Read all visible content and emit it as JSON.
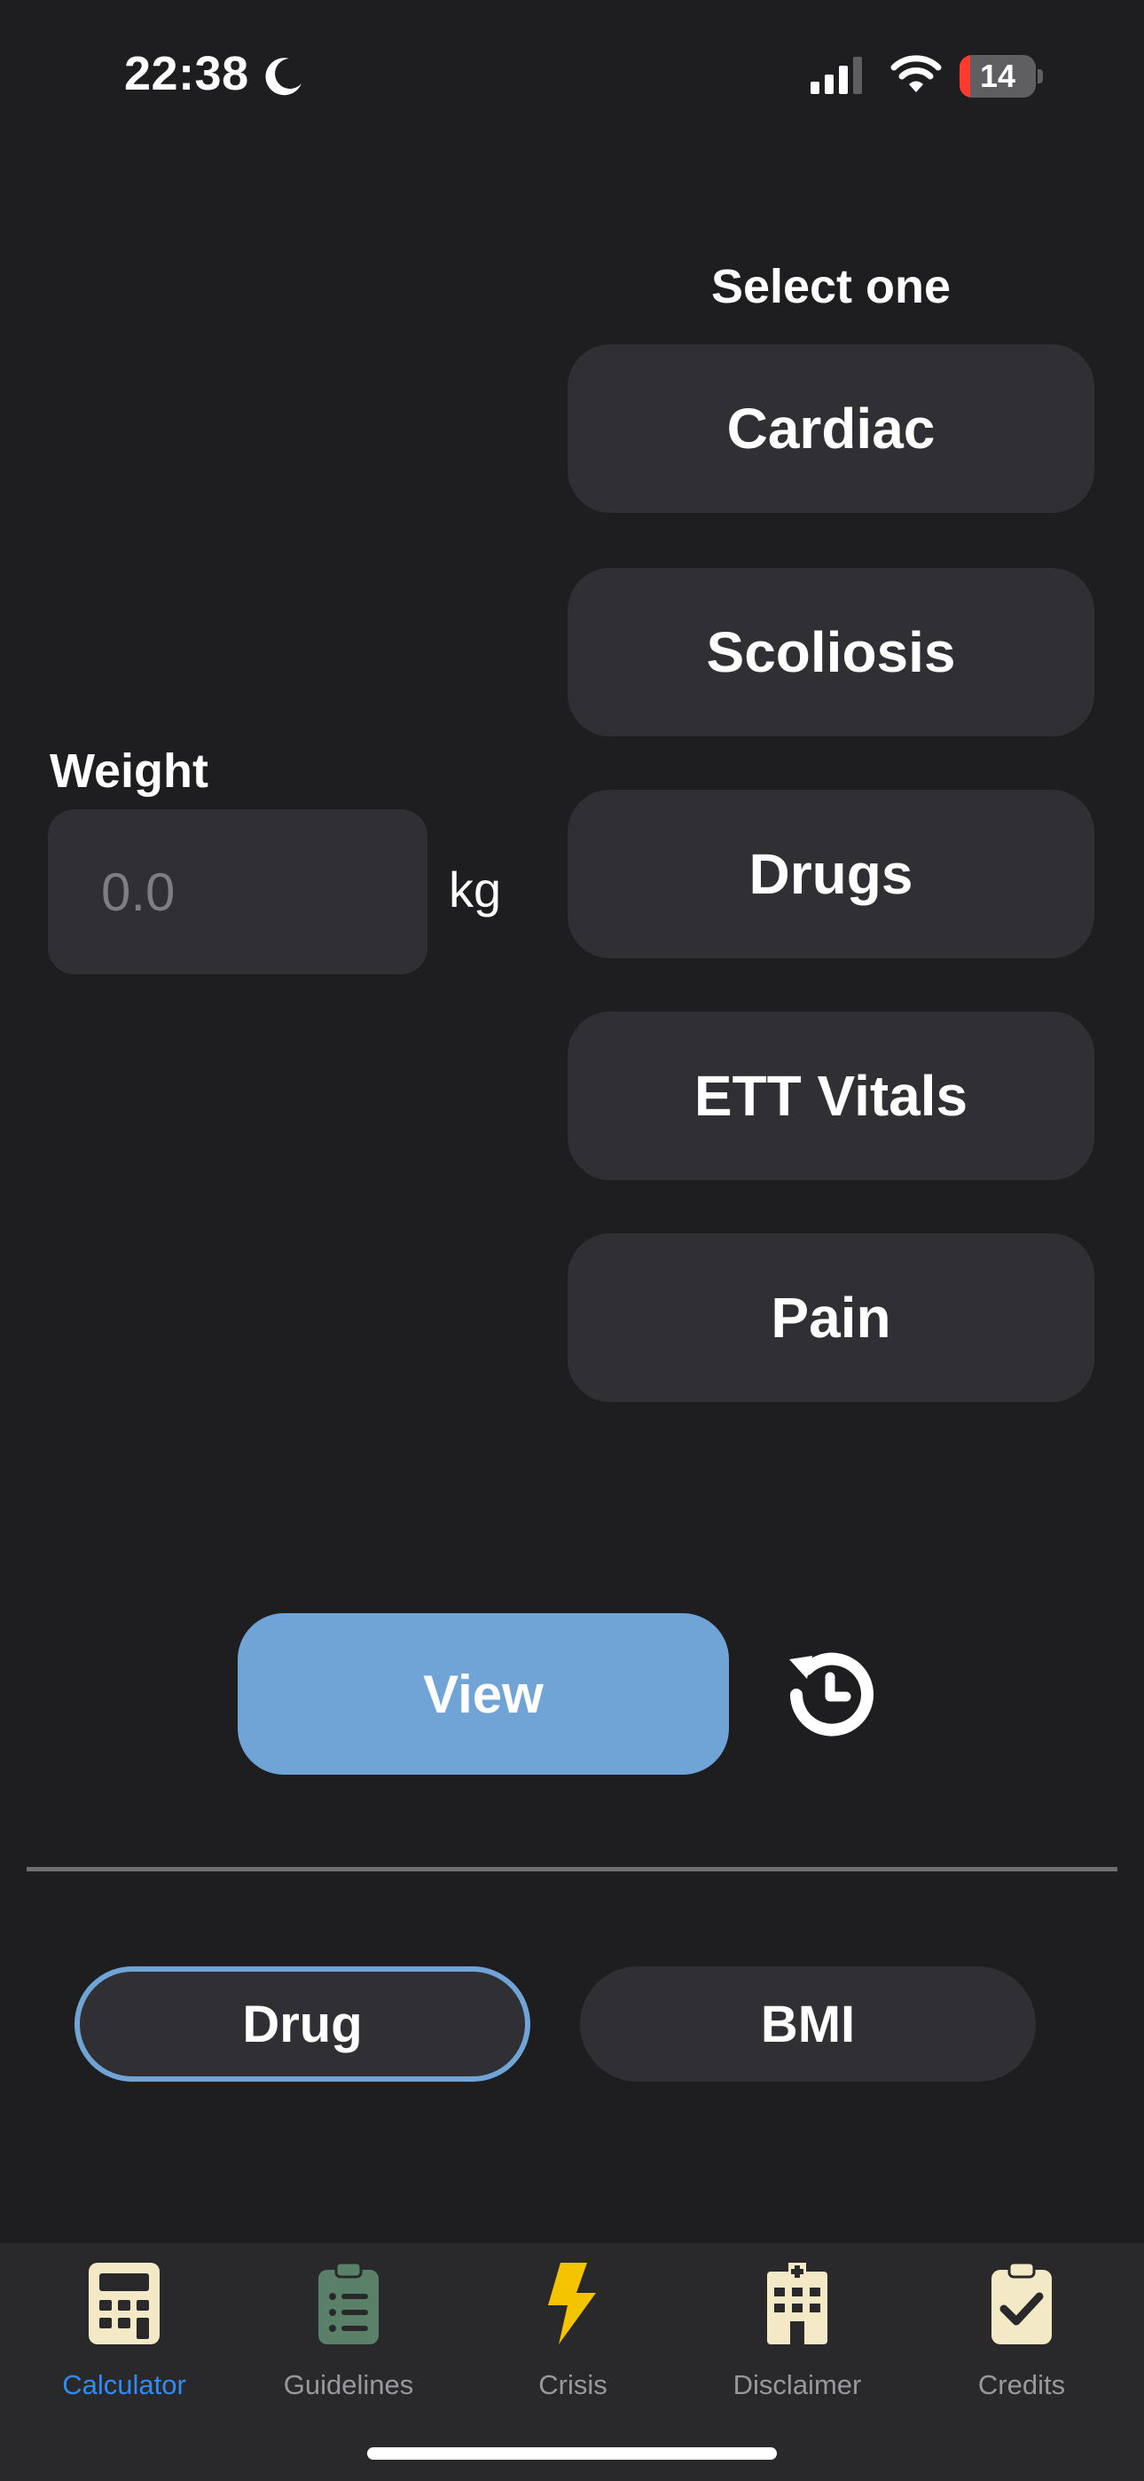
{
  "status_bar": {
    "time": "22:38",
    "battery_level": "14",
    "battery_fraction": 0.14
  },
  "selector": {
    "title": "Select one",
    "options": [
      "Cardiac",
      "Scoliosis",
      "Drugs",
      "ETT Vitals",
      "Pain"
    ]
  },
  "weight": {
    "label": "Weight",
    "placeholder": "0.0",
    "value": "",
    "unit": "kg"
  },
  "actions": {
    "view_label": "View"
  },
  "mode": {
    "options": [
      "Drug",
      "BMI"
    ],
    "selected": "Drug"
  },
  "tabs": [
    {
      "label": "Calculator",
      "icon": "calculator-icon",
      "active": true
    },
    {
      "label": "Guidelines",
      "icon": "clipboard-list-icon",
      "active": false
    },
    {
      "label": "Crisis",
      "icon": "lightning-bolt-icon",
      "active": false
    },
    {
      "label": "Disclaimer",
      "icon": "hospital-icon",
      "active": false
    },
    {
      "label": "Credits",
      "icon": "clipboard-check-icon",
      "active": false
    }
  ],
  "colors": {
    "background": "#1e1e20",
    "button": "#303034",
    "accent": "#70a4d6",
    "tab_active": "#2f8cf5",
    "icon_cream": "#f3e9c6",
    "icon_green": "#5b806a",
    "icon_yellow": "#f5c400",
    "battery_low": "#ff3b30"
  }
}
